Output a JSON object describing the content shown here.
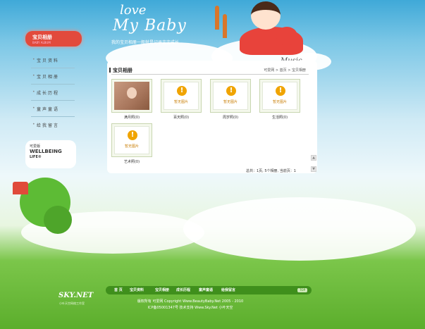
{
  "header": {
    "logo_love": "love",
    "logo_baby": "My Baby",
    "slogan": "我的宝贝相册一般就是记录宝宝成长"
  },
  "music_label": "Music",
  "sidebar": {
    "title": "宝贝相册",
    "subtitle": "BABY ALBUM",
    "items": [
      {
        "label": "宝贝资料"
      },
      {
        "label": "宝贝相册"
      },
      {
        "label": "成长历程"
      },
      {
        "label": "童声童语"
      },
      {
        "label": "给我留言"
      }
    ],
    "wellbeing": {
      "line1": "可爱版",
      "line2": "WELLBEING",
      "line3": "LIFE®"
    }
  },
  "content": {
    "title": "宝贝相册",
    "breadcrumb": "可爱网 > 首页 > 宝贝相册",
    "no_image_text": "暂无图片",
    "albums": [
      {
        "caption": "满月照(0)",
        "has_photo": true
      },
      {
        "caption": "百天照(0)",
        "has_photo": false
      },
      {
        "caption": "周岁照(0)",
        "has_photo": false
      },
      {
        "caption": "生活照(0)",
        "has_photo": false
      },
      {
        "caption": "艺术照(0)",
        "has_photo": false
      }
    ],
    "pagination": "总共：1页, 5个相册, 当前页：1"
  },
  "footer": {
    "nav": [
      {
        "label": "首 页"
      },
      {
        "label": "宝贝资料"
      },
      {
        "label": "宝贝相册"
      },
      {
        "label": "成长历程"
      },
      {
        "label": "童声童语"
      },
      {
        "label": "给我留言"
      }
    ],
    "badge": "TOP",
    "copyright_1": "版权所有 可爱网 Copyright Www.BeautyBaby.Net 2005 - 2010",
    "copyright_2": "ICP备05001347号 技术支持 Www.Sky.Net 小叶天空",
    "logo": "SKY.NET",
    "logo_sub": "小叶天空网络工作室"
  }
}
